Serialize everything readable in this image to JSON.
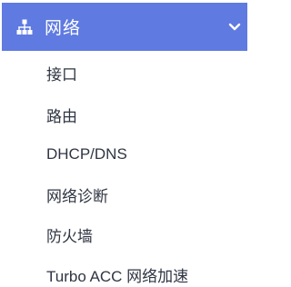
{
  "menu": {
    "title": "网络",
    "header_icon": "network-icon",
    "expand_icon": "chevron-down-icon",
    "accent_color": "#5f7ae0",
    "items": [
      {
        "label": "接口"
      },
      {
        "label": "路由"
      },
      {
        "label": "DHCP/DNS"
      },
      {
        "label": "网络诊断"
      },
      {
        "label": "防火墙"
      },
      {
        "label": "Turbo ACC 网络加速"
      }
    ]
  }
}
